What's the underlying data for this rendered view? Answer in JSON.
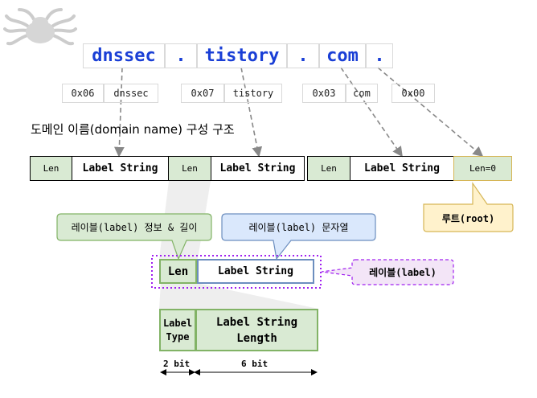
{
  "domain_row": [
    "dnssec",
    ".",
    "tistory",
    ".",
    "com",
    "."
  ],
  "hex_row": [
    {
      "hex": "0x06",
      "label": "dnssec"
    },
    {
      "hex": "0x07",
      "label": "tistory"
    },
    {
      "hex": "0x03",
      "label": "com"
    },
    {
      "hex": "0x00",
      "label": ""
    }
  ],
  "section_title": "도메인 이름(domain name) 구성 구조",
  "wire_row": {
    "len": "Len",
    "label_string": "Label String",
    "root_len": "Len=0"
  },
  "callouts": {
    "root": "루트(root)",
    "label_info": "레이블(label) 정보 & 길이",
    "label_string": "레이블(label) 문자열",
    "label": "레이블(label)"
  },
  "label_detail": {
    "len": "Len",
    "label_string": "Label String"
  },
  "len_detail": {
    "type": "Label Type",
    "length": "Label String Length"
  },
  "bits": {
    "type_bits": "2 bit",
    "length_bits": "6 bit"
  },
  "colors": {
    "domain_text": "#1a3fd6",
    "green_fill": "#d9ead3",
    "green_border": "#82b366",
    "yellow_fill": "#fff2cc",
    "yellow_border": "#d6b656",
    "blue_fill": "#dae8fc",
    "blue_border": "#6c8ebf",
    "purple": "#a020f0",
    "purple_fill": "#f3e5f7"
  }
}
